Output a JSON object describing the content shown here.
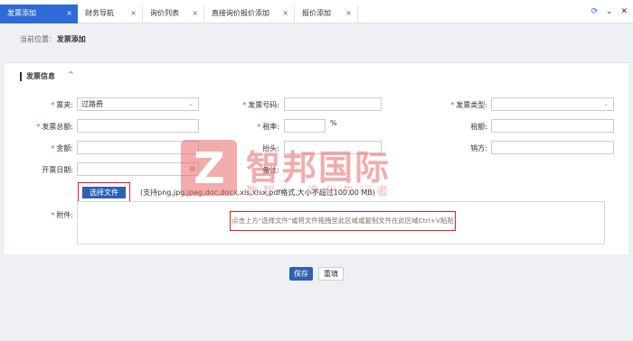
{
  "tabs": [
    {
      "label": "发票添加",
      "active": true
    },
    {
      "label": "财务导航",
      "active": false
    },
    {
      "label": "询价列表",
      "active": false
    },
    {
      "label": "直接询价报价添加",
      "active": false
    },
    {
      "label": "报价添加",
      "active": false
    }
  ],
  "tab_close": "×",
  "toolbar": {
    "refresh": "⟳",
    "menu": "⌄",
    "close": "✕"
  },
  "breadcrumb": {
    "prefix": "当前位置:",
    "current": "发票添加"
  },
  "section": {
    "title": "发票信息",
    "chevron": "^"
  },
  "form": {
    "invoice_type": {
      "label": "票夹:",
      "value": "过路费"
    },
    "invoice_no": {
      "label": "发票号码:",
      "value": ""
    },
    "invoice_kind": {
      "label": "发票类型:",
      "value": ""
    },
    "total": {
      "label": "发票总额:",
      "value": ""
    },
    "tax_rate": {
      "label": "税率:",
      "value": "",
      "unit": "%"
    },
    "tax_amount": {
      "label": "税额:",
      "value": ""
    },
    "amount": {
      "label": "金额:",
      "value": ""
    },
    "header": {
      "label": "抬头:",
      "value": ""
    },
    "seller": {
      "label": "销方:",
      "value": ""
    },
    "date": {
      "label": "开票日期:",
      "value": ""
    },
    "remark": {
      "label": "备注:",
      "value": ""
    },
    "attachment": {
      "label": "附件:"
    }
  },
  "upload": {
    "button": "选择文件",
    "hint": "(支持png,jpg,jpeg,doc,docx,xls,xlsx,pdf格式,大小不超过100.00 MB)",
    "drop_text": "点击上方\"选择文件\"或将文件拖拽至此区域或复制文件在此区域Ctrl+V粘贴"
  },
  "actions": {
    "save": "保存",
    "reset": "重填"
  },
  "watermark": {
    "logo_letter": "Z",
    "name": "智邦国际",
    "slogan": "数智 · 净化先行者"
  },
  "colors": {
    "accent": "#2f6bd6",
    "highlight": "#e02020",
    "required": "#e04040"
  }
}
